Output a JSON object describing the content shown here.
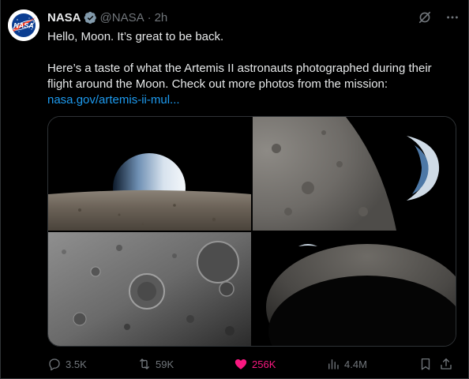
{
  "author": {
    "name": "NASA",
    "handle": "@NASA",
    "separator": "·",
    "time": "2h",
    "logo_text": "NASA"
  },
  "post": {
    "line1": "Hello, Moon. It’s great to be back.",
    "line2": "Here’s a taste of what the Artemis II astronauts photographed during their flight around the Moon. Check out more photos from the mission:",
    "link": "nasa.gov/artemis-ii-mul..."
  },
  "media": {
    "images": [
      {
        "icon": "earthrise-over-lunar-horizon"
      },
      {
        "icon": "crescent-earth-beside-moon-limb"
      },
      {
        "icon": "cratered-lunar-surface"
      },
      {
        "icon": "crescent-moon-with-tiny-earth"
      }
    ]
  },
  "actions": {
    "replies": "3.5K",
    "reposts": "59K",
    "likes": "256K",
    "views": "4.4M"
  },
  "colors": {
    "background": "#000000",
    "link": "#1d9bf0",
    "like": "#f91880",
    "muted": "#71767b",
    "verified": "#829aab"
  }
}
